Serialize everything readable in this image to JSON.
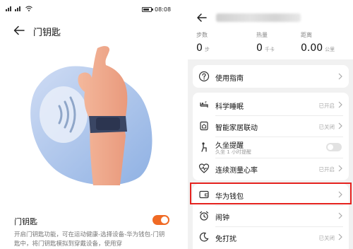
{
  "left_screen": {
    "status_bar": {
      "time": "08:08",
      "battery_level": 0.8
    },
    "header": {
      "title": "门钥匙"
    },
    "toggle": {
      "label": "门钥匙",
      "state": "on",
      "color": "#f06a24"
    },
    "description": "开启门钥匙功能，可在运动健康-选择设备-华为钱包-门钥匙中，将门钥匙模拟到穿戴设备，使用穿"
  },
  "right_screen": {
    "stats": [
      {
        "label": "步数",
        "value": "0",
        "unit": "步"
      },
      {
        "label": "热量",
        "value": "0",
        "unit": "千卡"
      },
      {
        "label": "距离",
        "value": "0.00",
        "unit": "公里"
      }
    ],
    "guide": {
      "label": "使用指南",
      "icon": "question-circle-icon"
    },
    "features": [
      {
        "label": "科学睡眠",
        "status": "已开启",
        "icon": "sleep-icon"
      },
      {
        "label": "智能家居联动",
        "status": "已关闭",
        "icon": "smart-home-icon"
      },
      {
        "label": "久坐提醒",
        "sub": "久坐 1 小时提醒",
        "icon": "sedentary-icon",
        "toggle": "off"
      },
      {
        "label": "连续测量心率",
        "status": "已开启",
        "icon": "heart-rate-icon"
      }
    ],
    "wallet": {
      "label": "华为钱包",
      "icon": "wallet-icon",
      "highlight_color": "#e5231f"
    },
    "more": [
      {
        "label": "闹钟",
        "icon": "alarm-icon"
      },
      {
        "label": "免打扰",
        "status": "已关闭",
        "icon": "do-not-disturb-icon"
      }
    ]
  }
}
